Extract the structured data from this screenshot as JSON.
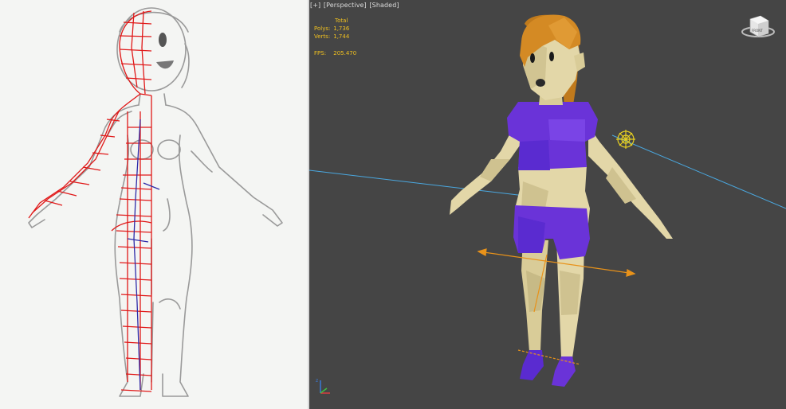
{
  "viewport": {
    "label_parts": [
      "[+]",
      "[Perspective]",
      "[Shaded]"
    ],
    "stats": {
      "header": "Total",
      "polys_label": "Polys:",
      "polys_value": "1,736",
      "verts_label": "Verts:",
      "verts_value": "1,744",
      "fps_label": "FPS:",
      "fps_value": "205.470"
    },
    "viewcube_label": "FRONT",
    "colors": {
      "background": "#454545",
      "skin": "#e3d7a8",
      "clothing": "#6a33d8",
      "hair": "#d48a24",
      "stats_text": "#f0c020",
      "gizmo": "#e8921a",
      "ground_line": "#4aa8e0"
    }
  },
  "sketch": {
    "colors": {
      "pencil": "#9a9a9a",
      "wire_red": "#e01818",
      "wire_blue": "#2e2aa8"
    }
  },
  "icons": [
    "viewcube-icon",
    "light-gizmo-icon",
    "move-gizmo-icon",
    "axis-tripod-icon"
  ]
}
